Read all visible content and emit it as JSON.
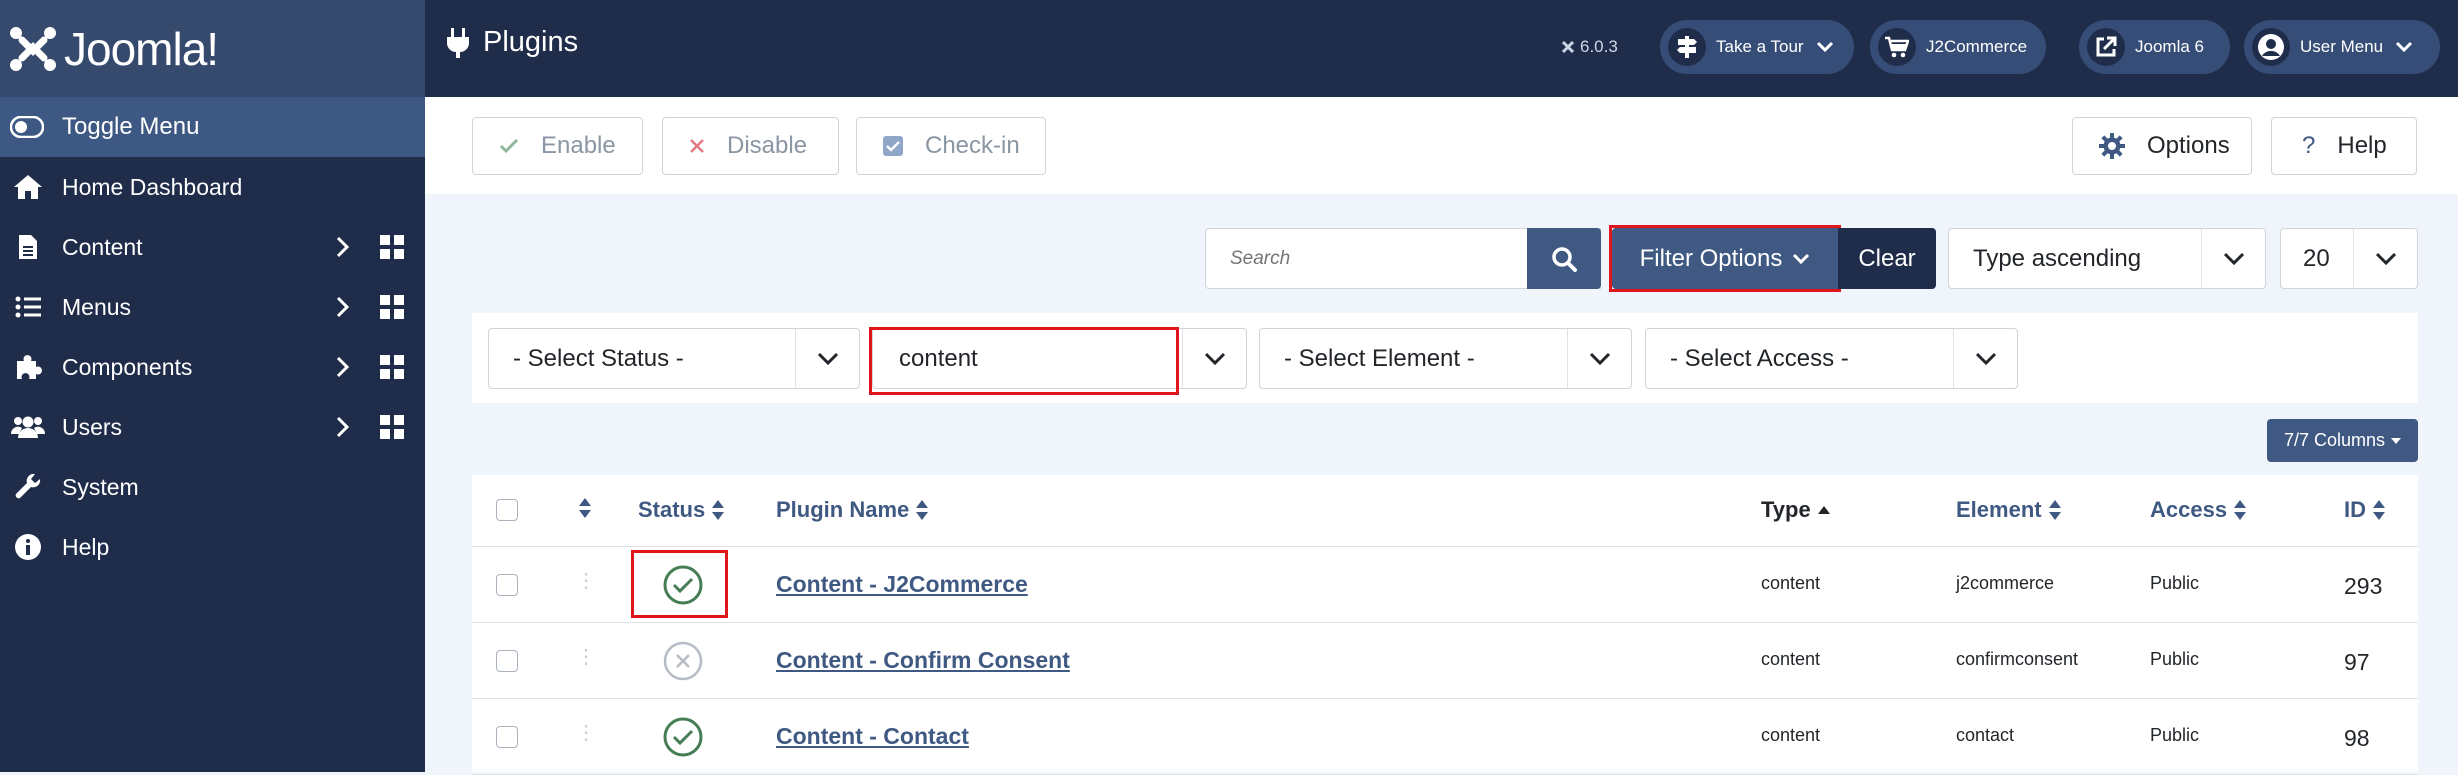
{
  "sidebar": {
    "brand": "Joomla!",
    "toggle_label": "Toggle Menu",
    "items": [
      {
        "label": "Home Dashboard",
        "icon": "home-icon"
      },
      {
        "label": "Content",
        "icon": "file-icon"
      },
      {
        "label": "Menus",
        "icon": "list-icon"
      },
      {
        "label": "Components",
        "icon": "puzzle-icon"
      },
      {
        "label": "Users",
        "icon": "users-icon"
      },
      {
        "label": "System",
        "icon": "wrench-icon"
      },
      {
        "label": "Help",
        "icon": "info-icon"
      }
    ]
  },
  "header": {
    "title": "Plugins",
    "version": "6.0.3",
    "buttons": {
      "tour": "Take a Tour",
      "j2commerce": "J2Commerce",
      "joomla6": "Joomla 6",
      "user_menu": "User Menu"
    }
  },
  "toolbar": {
    "enable": "Enable",
    "disable": "Disable",
    "checkin": "Check-in",
    "options": "Options",
    "help": "Help"
  },
  "search": {
    "placeholder": "Search",
    "filter_options": "Filter Options",
    "clear": "Clear",
    "ordering": "Type ascending",
    "limit": "20"
  },
  "filters": {
    "status": "- Select Status -",
    "type": "content",
    "element": "- Select Element -",
    "access": "- Select Access -"
  },
  "columns_button": "7/7 Columns",
  "table": {
    "headers": {
      "status": "Status",
      "name": "Plugin Name",
      "type": "Type",
      "element": "Element",
      "access": "Access",
      "id": "ID"
    },
    "rows": [
      {
        "name": "Content - J2Commerce",
        "type": "content",
        "element": "j2commerce",
        "access": "Public",
        "id": "293",
        "enabled": true
      },
      {
        "name": "Content - Confirm Consent",
        "type": "content",
        "element": "confirmconsent",
        "access": "Public",
        "id": "97",
        "enabled": false
      },
      {
        "name": "Content - Contact",
        "type": "content",
        "element": "contact",
        "access": "Public",
        "id": "98",
        "enabled": true
      }
    ]
  },
  "colors": {
    "sidebar_bg": "#1f2c4a",
    "accent": "#3f5982",
    "success": "#457d54",
    "highlight_border": "#e0161c"
  }
}
